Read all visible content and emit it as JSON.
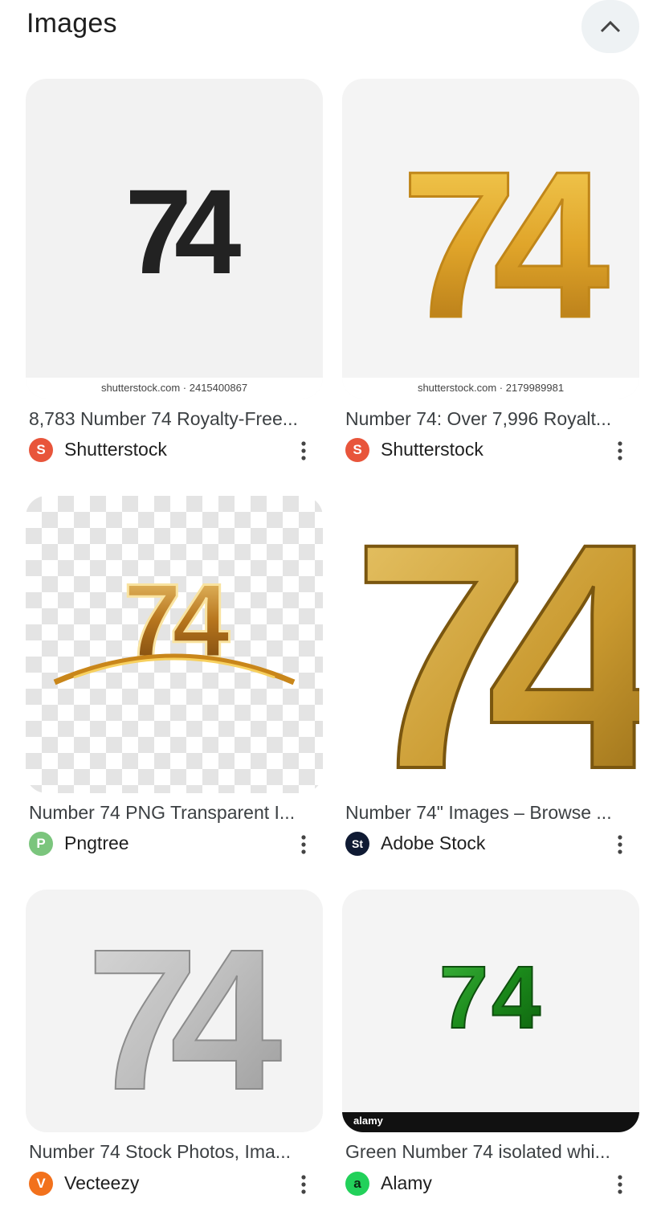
{
  "header": {
    "title": "Images",
    "collapse_icon": "chevron-up-icon"
  },
  "results": [
    {
      "caption": "8,783 Number 74 Royalty-Free...",
      "source": "Shutterstock",
      "favicon_color": "#e8553b",
      "favicon_glyph": "S",
      "watermark": "shutterstock.com · 2415400867",
      "image_text": "74"
    },
    {
      "caption": "Number 74: Over 7,996 Royalt...",
      "source": "Shutterstock",
      "favicon_color": "#e8553b",
      "favicon_glyph": "S",
      "watermark": "shutterstock.com · 2179989981",
      "image_text": "74"
    },
    {
      "caption": "Number 74 PNG Transparent I...",
      "source": "Pngtree",
      "favicon_color": "#7bc57d",
      "favicon_glyph": "P",
      "image_text": "74"
    },
    {
      "caption": "Number 74\" Images – Browse ...",
      "source": "Adobe Stock",
      "favicon_color": "#0f1a33",
      "favicon_glyph": "St",
      "image_text": "74"
    },
    {
      "caption": "Number 74 Stock Photos, Ima...",
      "source": "Vecteezy",
      "favicon_color": "#f2711c",
      "favicon_glyph": "V",
      "image_text": "74"
    },
    {
      "caption": "Green Number 74 isolated whi...",
      "source": "Alamy",
      "favicon_color": "#22d15a",
      "favicon_glyph": "a",
      "watermark": "alamy",
      "image_text": "74"
    }
  ]
}
